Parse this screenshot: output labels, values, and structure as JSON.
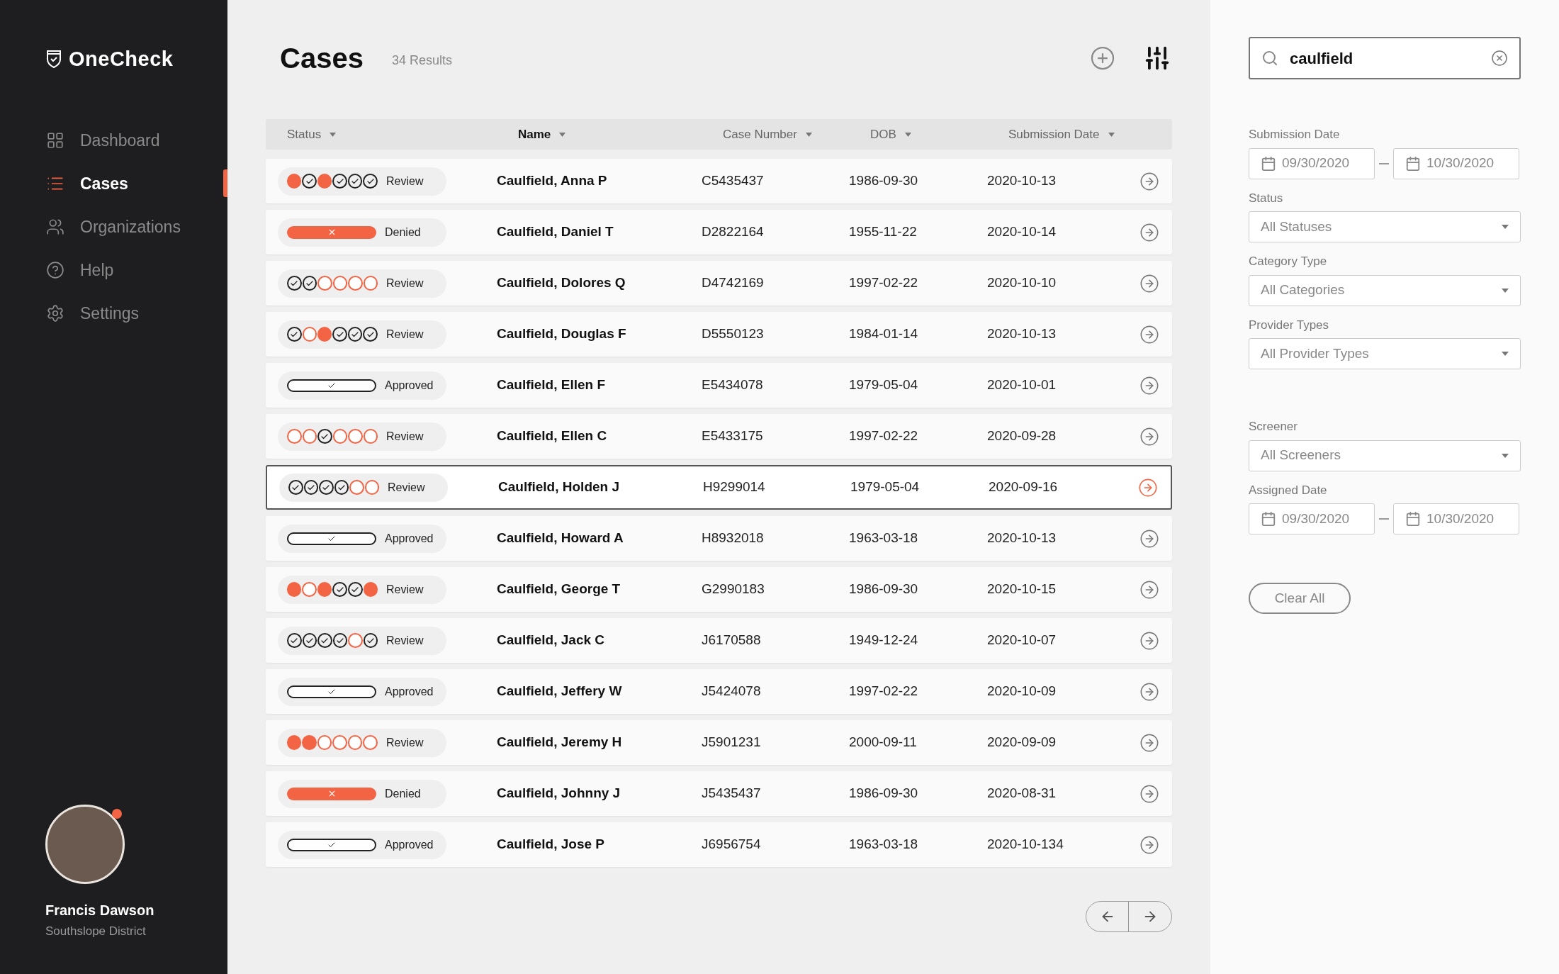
{
  "brand": {
    "name": "OneCheck"
  },
  "nav": [
    {
      "label": "Dashboard",
      "selected": false
    },
    {
      "label": "Cases",
      "selected": true
    },
    {
      "label": "Organizations",
      "selected": false
    },
    {
      "label": "Help",
      "selected": false
    },
    {
      "label": "Settings",
      "selected": false
    }
  ],
  "user": {
    "name": "Francis Dawson",
    "district": "Southslope District"
  },
  "header": {
    "title": "Cases",
    "count": "34 Results"
  },
  "table": {
    "columns": [
      "Status",
      "Name",
      "Case Number",
      "DOB",
      "Submission Date"
    ],
    "rows": [
      {
        "kind": "review",
        "label": "Review",
        "steps": [
          {
            "kind": "flag"
          },
          {
            "kind": "done"
          },
          {
            "kind": "flag"
          },
          {
            "kind": "done"
          },
          {
            "kind": "done"
          },
          {
            "kind": "done"
          }
        ],
        "name": "Caulfield, Anna P",
        "case": "C5435437",
        "dob": "1986-09-30",
        "submitted": "2020-10-13",
        "selected": false
      },
      {
        "kind": "denied",
        "label": "Denied",
        "name": "Caulfield, Daniel T",
        "case": "D2822164",
        "dob": "1955-11-22",
        "submitted": "2020-10-14",
        "selected": false
      },
      {
        "kind": "review",
        "label": "Review",
        "steps": [
          {
            "kind": "done"
          },
          {
            "kind": "done"
          },
          {
            "kind": "open"
          },
          {
            "kind": "open"
          },
          {
            "kind": "open"
          },
          {
            "kind": "open"
          }
        ],
        "name": "Caulfield, Dolores Q",
        "case": "D4742169",
        "dob": "1997-02-22",
        "submitted": "2020-10-10",
        "selected": false
      },
      {
        "kind": "review",
        "label": "Review",
        "steps": [
          {
            "kind": "done"
          },
          {
            "kind": "open"
          },
          {
            "kind": "flag"
          },
          {
            "kind": "done"
          },
          {
            "kind": "done"
          },
          {
            "kind": "done"
          }
        ],
        "name": "Caulfield, Douglas F",
        "case": "D5550123",
        "dob": "1984-01-14",
        "submitted": "2020-10-13",
        "selected": false
      },
      {
        "kind": "approved",
        "label": "Approved",
        "name": "Caulfield, Ellen F",
        "case": "E5434078",
        "dob": "1979-05-04",
        "submitted": "2020-10-01",
        "selected": false
      },
      {
        "kind": "review",
        "label": "Review",
        "steps": [
          {
            "kind": "open"
          },
          {
            "kind": "open"
          },
          {
            "kind": "done"
          },
          {
            "kind": "open"
          },
          {
            "kind": "open"
          },
          {
            "kind": "open"
          }
        ],
        "name": "Caulfield, Ellen C",
        "case": "E5433175",
        "dob": "1997-02-22",
        "submitted": "2020-09-28",
        "selected": false
      },
      {
        "kind": "review",
        "label": "Review",
        "steps": [
          {
            "kind": "done"
          },
          {
            "kind": "done"
          },
          {
            "kind": "done"
          },
          {
            "kind": "done"
          },
          {
            "kind": "open"
          },
          {
            "kind": "open"
          }
        ],
        "name": "Caulfield, Holden J",
        "case": "H9299014",
        "dob": "1979-05-04",
        "submitted": "2020-09-16",
        "selected": true
      },
      {
        "kind": "approved",
        "label": "Approved",
        "name": "Caulfield, Howard A",
        "case": "H8932018",
        "dob": "1963-03-18",
        "submitted": "2020-10-13",
        "selected": false
      },
      {
        "kind": "review",
        "label": "Review",
        "steps": [
          {
            "kind": "flag"
          },
          {
            "kind": "open"
          },
          {
            "kind": "flag"
          },
          {
            "kind": "done"
          },
          {
            "kind": "done"
          },
          {
            "kind": "flag"
          }
        ],
        "name": "Caulfield, George T",
        "case": "G2990183",
        "dob": "1986-09-30",
        "submitted": "2020-10-15",
        "selected": false
      },
      {
        "kind": "review",
        "label": "Review",
        "steps": [
          {
            "kind": "done"
          },
          {
            "kind": "done"
          },
          {
            "kind": "done"
          },
          {
            "kind": "done"
          },
          {
            "kind": "open"
          },
          {
            "kind": "done"
          }
        ],
        "name": "Caulfield, Jack C",
        "case": "J6170588",
        "dob": "1949-12-24",
        "submitted": "2020-10-07",
        "selected": false
      },
      {
        "kind": "approved",
        "label": "Approved",
        "name": "Caulfield, Jeffery W",
        "case": "J5424078",
        "dob": "1997-02-22",
        "submitted": "2020-10-09",
        "selected": false
      },
      {
        "kind": "review",
        "label": "Review",
        "steps": [
          {
            "kind": "flag"
          },
          {
            "kind": "flag"
          },
          {
            "kind": "open"
          },
          {
            "kind": "open"
          },
          {
            "kind": "open"
          },
          {
            "kind": "open"
          }
        ],
        "name": "Caulfield, Jeremy H",
        "case": "J5901231",
        "dob": "2000-09-11",
        "submitted": "2020-09-09",
        "selected": false
      },
      {
        "kind": "denied",
        "label": "Denied",
        "name": "Caulfield, Johnny J",
        "case": "J5435437",
        "dob": "1986-09-30",
        "submitted": "2020-08-31",
        "selected": false
      },
      {
        "kind": "approved",
        "label": "Approved",
        "name": "Caulfield, Jose P",
        "case": "J6956754",
        "dob": "1963-03-18",
        "submitted": "2020-10-134",
        "selected": false
      }
    ]
  },
  "filters": {
    "search": {
      "value": "caulfield"
    },
    "fields": [
      {
        "kind": "daterange",
        "label": "Submission Date",
        "from": "09/30/2020",
        "to": "10/30/2020"
      },
      {
        "kind": "select",
        "label": "Status",
        "value": "All Statuses"
      },
      {
        "kind": "select",
        "label": "Category Type",
        "value": "All Categories"
      },
      {
        "kind": "select",
        "label": "Provider Types",
        "value": "All Provider Types"
      },
      {
        "kind": "gap"
      },
      {
        "kind": "select",
        "label": "Screener",
        "value": "All Screeners"
      },
      {
        "kind": "daterange",
        "label": "Assigned Date",
        "from": "09/30/2020",
        "to": "10/30/2020"
      }
    ],
    "clear": "Clear All"
  }
}
